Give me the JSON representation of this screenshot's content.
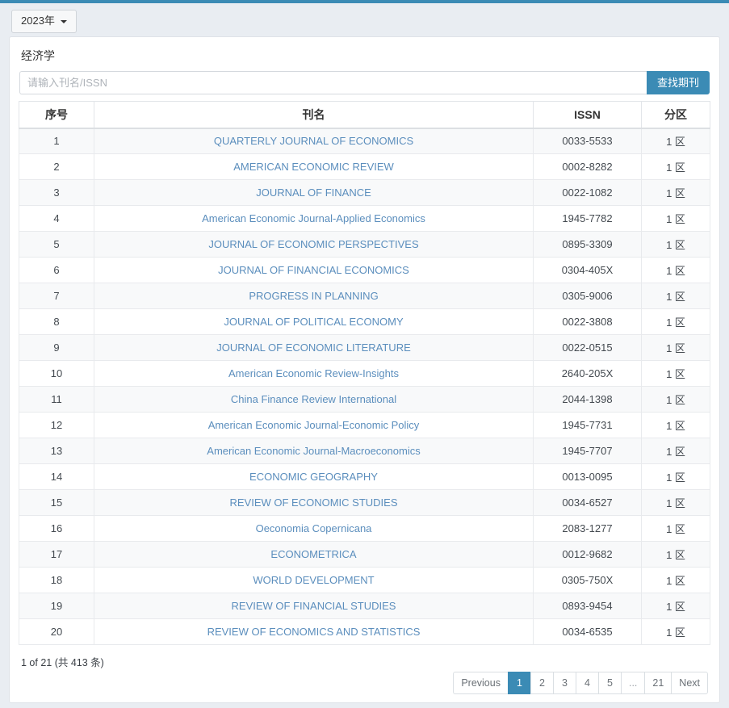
{
  "theme": {
    "accent": "#3b8bb5",
    "page_bg": "#e9edf2",
    "link": "#5b8ebd",
    "row_stripe": "#f8f9fa"
  },
  "year_selector": {
    "label": "2023年",
    "icon": "chevron-down-icon"
  },
  "panel": {
    "title": "经济学"
  },
  "search": {
    "placeholder": "请输入刊名/ISSN",
    "value": "",
    "button_label": "查找期刊"
  },
  "table": {
    "headers": {
      "index": "序号",
      "name": "刊名",
      "issn": "ISSN",
      "zone": "分区"
    },
    "rows": [
      {
        "index": "1",
        "name": "QUARTERLY JOURNAL OF ECONOMICS",
        "issn": "0033-5533",
        "zone": "1 区"
      },
      {
        "index": "2",
        "name": "AMERICAN ECONOMIC REVIEW",
        "issn": "0002-8282",
        "zone": "1 区"
      },
      {
        "index": "3",
        "name": "JOURNAL OF FINANCE",
        "issn": "0022-1082",
        "zone": "1 区"
      },
      {
        "index": "4",
        "name": "American Economic Journal-Applied Economics",
        "issn": "1945-7782",
        "zone": "1 区"
      },
      {
        "index": "5",
        "name": "JOURNAL OF ECONOMIC PERSPECTIVES",
        "issn": "0895-3309",
        "zone": "1 区"
      },
      {
        "index": "6",
        "name": "JOURNAL OF FINANCIAL ECONOMICS",
        "issn": "0304-405X",
        "zone": "1 区"
      },
      {
        "index": "7",
        "name": "PROGRESS IN PLANNING",
        "issn": "0305-9006",
        "zone": "1 区"
      },
      {
        "index": "8",
        "name": "JOURNAL OF POLITICAL ECONOMY",
        "issn": "0022-3808",
        "zone": "1 区"
      },
      {
        "index": "9",
        "name": "JOURNAL OF ECONOMIC LITERATURE",
        "issn": "0022-0515",
        "zone": "1 区"
      },
      {
        "index": "10",
        "name": "American Economic Review-Insights",
        "issn": "2640-205X",
        "zone": "1 区"
      },
      {
        "index": "11",
        "name": "China Finance Review International",
        "issn": "2044-1398",
        "zone": "1 区"
      },
      {
        "index": "12",
        "name": "American Economic Journal-Economic Policy",
        "issn": "1945-7731",
        "zone": "1 区"
      },
      {
        "index": "13",
        "name": "American Economic Journal-Macroeconomics",
        "issn": "1945-7707",
        "zone": "1 区"
      },
      {
        "index": "14",
        "name": "ECONOMIC GEOGRAPHY",
        "issn": "0013-0095",
        "zone": "1 区"
      },
      {
        "index": "15",
        "name": "REVIEW OF ECONOMIC STUDIES",
        "issn": "0034-6527",
        "zone": "1 区"
      },
      {
        "index": "16",
        "name": "Oeconomia Copernicana",
        "issn": "2083-1277",
        "zone": "1 区"
      },
      {
        "index": "17",
        "name": "ECONOMETRICA",
        "issn": "0012-9682",
        "zone": "1 区"
      },
      {
        "index": "18",
        "name": "WORLD DEVELOPMENT",
        "issn": "0305-750X",
        "zone": "1 区"
      },
      {
        "index": "19",
        "name": "REVIEW OF FINANCIAL STUDIES",
        "issn": "0893-9454",
        "zone": "1 区"
      },
      {
        "index": "20",
        "name": "REVIEW OF ECONOMICS AND STATISTICS",
        "issn": "0034-6535",
        "zone": "1 区"
      }
    ]
  },
  "footer": {
    "count_text": "1 of 21 (共 413 条)",
    "pagination": {
      "previous_label": "Previous",
      "next_label": "Next",
      "pages": [
        "1",
        "2",
        "3",
        "4",
        "5",
        "...",
        "21"
      ],
      "active_page": "1"
    }
  }
}
